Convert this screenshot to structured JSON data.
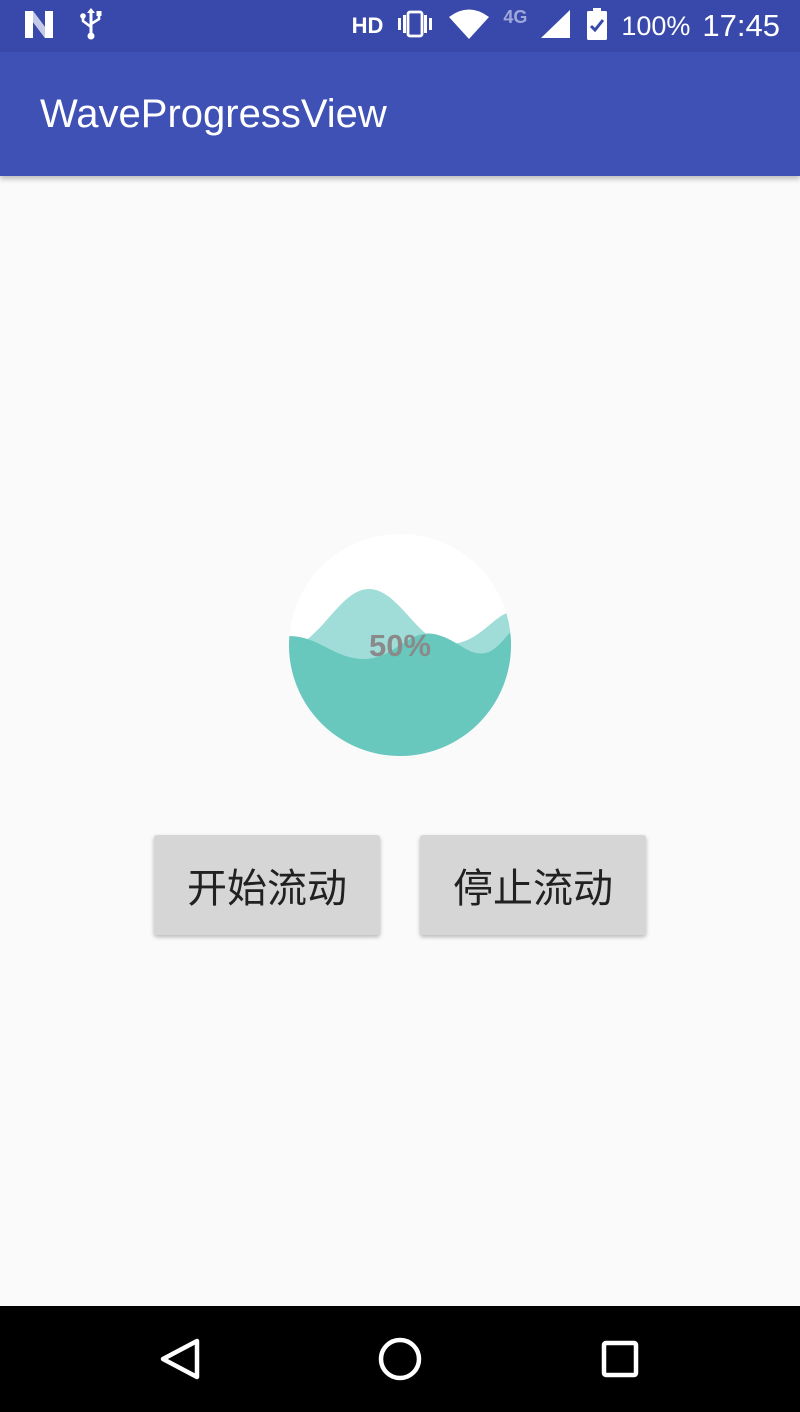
{
  "status_bar": {
    "hd": "HD",
    "network": "4G",
    "battery": "100%",
    "time": "17:45",
    "icons": [
      "notification-n-icon",
      "usb-icon",
      "vibrate-icon",
      "wifi-icon",
      "signal-icon",
      "battery-icon"
    ]
  },
  "app_bar": {
    "title": "WaveProgressView"
  },
  "wave_progress": {
    "label": "50%",
    "progress": 0.5,
    "colors": {
      "back_wave": "#a0ddd8",
      "front_wave": "#68c8bd",
      "background": "#ffffff",
      "text": "#8a8a8a"
    }
  },
  "buttons": {
    "start_label": "开始流动",
    "stop_label": "停止流动"
  },
  "nav_bar": {
    "icons": [
      "back-icon",
      "home-icon",
      "recents-icon"
    ]
  },
  "colors": {
    "status_bar": "#3949ab",
    "app_bar": "#3f51b5",
    "screen_bg": "#fafafa",
    "button_bg": "#d6d6d6"
  }
}
